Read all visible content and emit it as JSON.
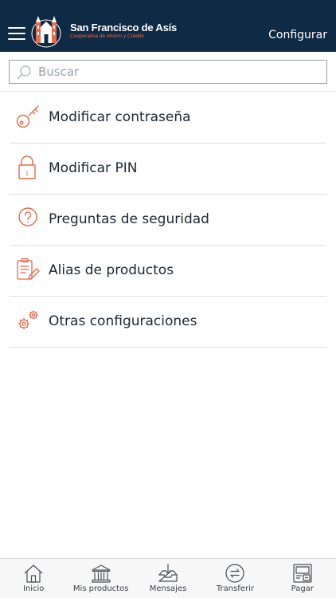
{
  "header": {
    "menu_icon": "hamburger-icon",
    "brand_name": "San Francisco de Asís",
    "brand_subtitle": "Cooperativa de Ahorro y Crédito",
    "action_label": "Configurar"
  },
  "search": {
    "icon": "search-icon",
    "placeholder": "Buscar",
    "value": ""
  },
  "menu": {
    "items": [
      {
        "label": "Modificar contraseña",
        "icon": "key-icon"
      },
      {
        "label": "Modificar PIN",
        "icon": "padlock-icon"
      },
      {
        "label": "Preguntas de seguridad",
        "icon": "question-icon"
      },
      {
        "label": "Alias de productos",
        "icon": "clipboard-edit-icon"
      },
      {
        "label": "Otras configuraciones",
        "icon": "gears-icon"
      }
    ]
  },
  "bottom_nav": {
    "items": [
      {
        "label": "Inicio",
        "icon": "home-icon"
      },
      {
        "label": "Mis productos",
        "icon": "bank-icon"
      },
      {
        "label": "Mensajes",
        "icon": "inbox-icon"
      },
      {
        "label": "Transferir",
        "icon": "transfer-icon"
      },
      {
        "label": "Pagar",
        "icon": "pay-icon"
      }
    ]
  },
  "colors": {
    "header_bg": "#0f2a44",
    "accent": "#e86a4a",
    "text": "#1e2633"
  }
}
